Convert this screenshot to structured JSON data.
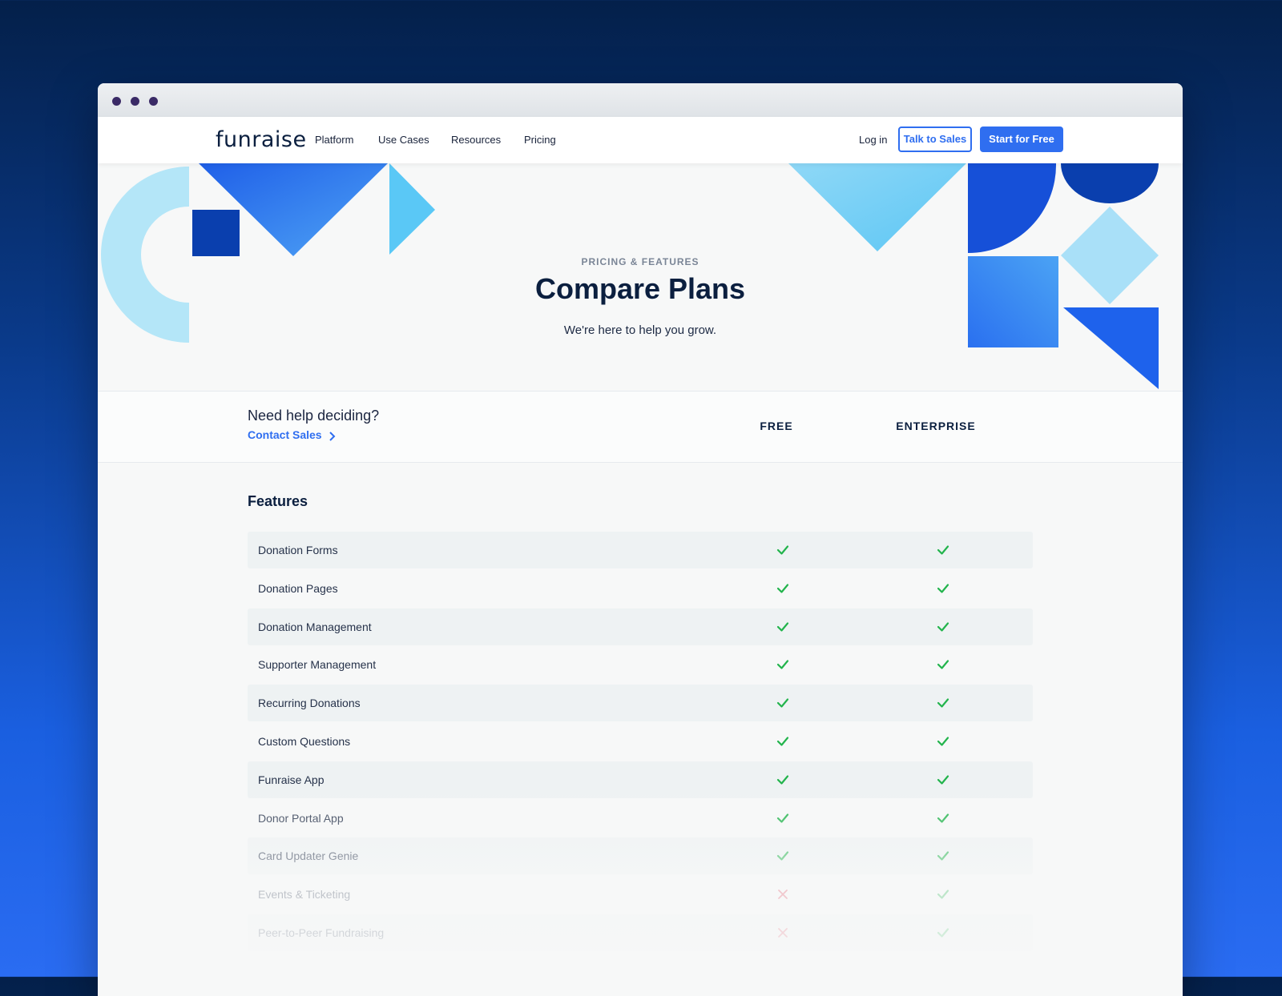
{
  "window": {
    "controls": [
      "dot",
      "dot",
      "dot"
    ]
  },
  "nav": {
    "logo": "funraise",
    "links": [
      "Platform",
      "Use Cases",
      "Resources",
      "Pricing"
    ],
    "login": "Log in",
    "talk_to_sales": "Talk to Sales",
    "start_for_free": "Start for Free"
  },
  "hero": {
    "eyebrow": "PRICING & FEATURES",
    "title": "Compare Plans",
    "subtitle": "We're here to help you grow."
  },
  "plans": {
    "help_text": "Need help deciding?",
    "contact_sales": "Contact Sales",
    "columns": [
      "FREE",
      "ENTERPRISE"
    ]
  },
  "features": {
    "title": "Features",
    "rows": [
      {
        "label": "Donation Forms",
        "free": true,
        "enterprise": true
      },
      {
        "label": "Donation Pages",
        "free": true,
        "enterprise": true
      },
      {
        "label": "Donation Management",
        "free": true,
        "enterprise": true
      },
      {
        "label": "Supporter Management",
        "free": true,
        "enterprise": true
      },
      {
        "label": "Recurring Donations",
        "free": true,
        "enterprise": true
      },
      {
        "label": "Custom Questions",
        "free": true,
        "enterprise": true
      },
      {
        "label": "Funraise App",
        "free": true,
        "enterprise": true
      },
      {
        "label": "Donor Portal App",
        "free": true,
        "enterprise": true
      },
      {
        "label": "Card Updater Genie",
        "free": true,
        "enterprise": true
      },
      {
        "label": "Events & Ticketing",
        "free": false,
        "enterprise": true
      },
      {
        "label": "Peer-to-Peer Fundraising",
        "free": false,
        "enterprise": true
      }
    ]
  },
  "colors": {
    "accent": "#2f6ef0",
    "check": "#22b44c",
    "cross": "#e0455a",
    "heading": "#0b1f3f"
  },
  "icons": {
    "check": "check-icon",
    "cross": "cross-icon",
    "chevron": "chevron-right-icon"
  }
}
